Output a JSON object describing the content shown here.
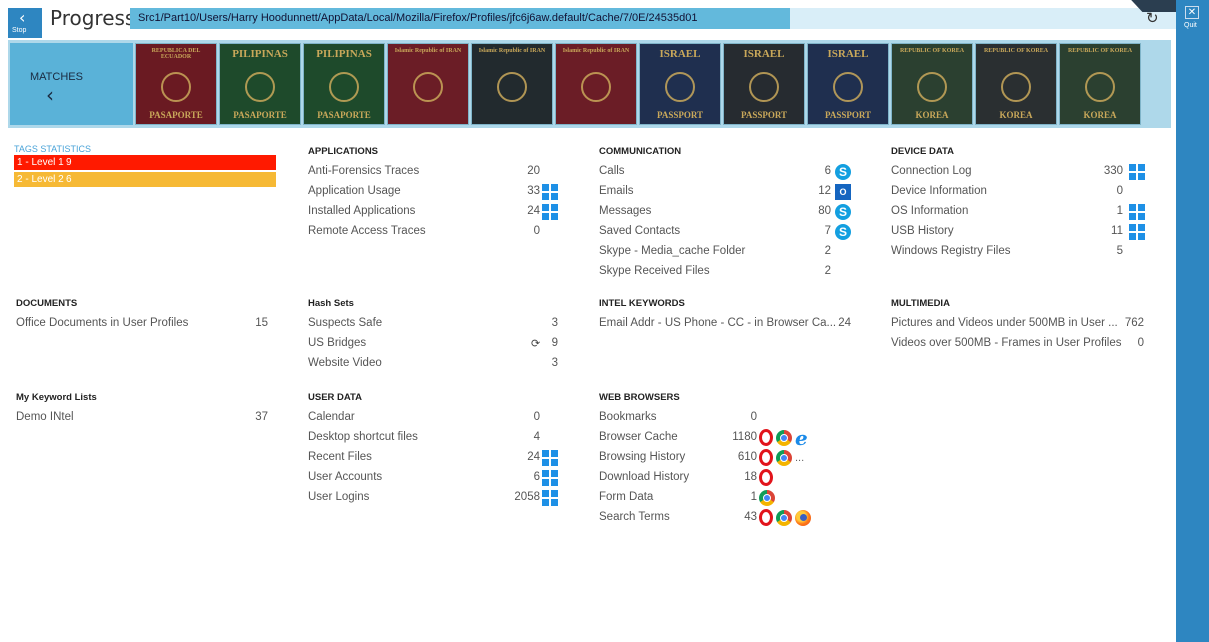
{
  "window": {
    "title": "Progress",
    "stop_label": "Stop",
    "quit_label": "Quit",
    "path": "Src1/Part10/Users/Harry Hoodunnett/AppData/Local/Mozilla/Firefox/Profiles/jfc6j6aw.default/Cache/7/0E/24535d01"
  },
  "matches": {
    "label": "MATCHES",
    "passports": [
      {
        "country": "REPUBLICA DEL ECUADOR",
        "bottom": "PASAPORTE",
        "color": "#6a1a22"
      },
      {
        "country": "PILIPINAS",
        "bottom": "PASAPORTE",
        "color": "#1e4a2b"
      },
      {
        "country": "PILIPINAS",
        "bottom": "PASAPORTE",
        "color": "#1e4a2b"
      },
      {
        "country": "Islamic Republic of IRAN",
        "bottom": "",
        "color": "#6b1d26"
      },
      {
        "country": "Islamic Republic of IRAN",
        "bottom": "",
        "color": "#222a2e"
      },
      {
        "country": "Islamic Republic of IRAN",
        "bottom": "",
        "color": "#6b1d26"
      },
      {
        "country": "ISRAEL",
        "bottom": "PASSPORT",
        "color": "#1f2f4f"
      },
      {
        "country": "ISRAEL",
        "bottom": "PASSPORT",
        "color": "#262b30"
      },
      {
        "country": "ISRAEL",
        "bottom": "PASSPORT",
        "color": "#1f2f4f"
      },
      {
        "country": "REPUBLIC OF KOREA",
        "bottom": "KOREA",
        "color": "#2b4030"
      },
      {
        "country": "REPUBLIC OF KOREA",
        "bottom": "KOREA",
        "color": "#2a2f31"
      },
      {
        "country": "REPUBLIC OF KOREA",
        "bottom": "KOREA",
        "color": "#2b4030"
      }
    ]
  },
  "tags": {
    "title": "TAGS STATISTICS",
    "items": [
      {
        "label": "1 - Level 1",
        "count": "9",
        "color": "#ff1a00"
      },
      {
        "label": "2 - Level 2",
        "count": "6",
        "color": "#f6b935"
      }
    ]
  },
  "sections": {
    "applications": {
      "title": "APPLICATIONS",
      "rows": [
        {
          "name": "Anti-Forensics Traces",
          "value": "20"
        },
        {
          "name": "Application Usage",
          "value": "33"
        },
        {
          "name": "Installed Applications",
          "value": "24"
        },
        {
          "name": "Remote Access Traces",
          "value": "0"
        }
      ]
    },
    "communication": {
      "title": "COMMUNICATION",
      "rows": [
        {
          "name": "Calls",
          "value": "6"
        },
        {
          "name": "Emails",
          "value": "12"
        },
        {
          "name": "Messages",
          "value": "80"
        },
        {
          "name": "Saved Contacts",
          "value": "7"
        },
        {
          "name": "Skype - Media_cache Folder",
          "value": "2"
        },
        {
          "name": "Skype Received Files",
          "value": "2"
        }
      ]
    },
    "device_data": {
      "title": "DEVICE DATA",
      "rows": [
        {
          "name": "Connection Log",
          "value": "330"
        },
        {
          "name": "Device Information",
          "value": "0"
        },
        {
          "name": "OS Information",
          "value": "1"
        },
        {
          "name": "USB History",
          "value": "11"
        },
        {
          "name": "Windows Registry Files",
          "value": "5"
        }
      ]
    },
    "documents": {
      "title": "DOCUMENTS",
      "rows": [
        {
          "name": "Office Documents in User Profiles",
          "value": "15"
        }
      ]
    },
    "hash_sets": {
      "title": "Hash Sets",
      "rows": [
        {
          "name": "Suspects Safe",
          "value": "3"
        },
        {
          "name": "US Bridges",
          "value": "9"
        },
        {
          "name": "Website Video",
          "value": "3"
        }
      ]
    },
    "intel_keywords": {
      "title": "INTEL KEYWORDS",
      "rows": [
        {
          "name": "Email Addr - US Phone - CC - in Browser Ca...",
          "value": "24"
        }
      ]
    },
    "multimedia": {
      "title": "MULTIMEDIA",
      "rows": [
        {
          "name": "Pictures and Videos under 500MB in User ...",
          "value": "762"
        },
        {
          "name": "Videos over 500MB - Frames in User Profiles",
          "value": "0"
        }
      ]
    },
    "keyword_lists": {
      "title": "My Keyword Lists",
      "rows": [
        {
          "name": "Demo INtel",
          "value": "37"
        }
      ]
    },
    "user_data": {
      "title": "USER DATA",
      "rows": [
        {
          "name": "Calendar",
          "value": "0"
        },
        {
          "name": "Desktop shortcut files",
          "value": "4"
        },
        {
          "name": "Recent Files",
          "value": "24"
        },
        {
          "name": "User Accounts",
          "value": "6"
        },
        {
          "name": "User Logins",
          "value": "2058"
        }
      ]
    },
    "web_browsers": {
      "title": "WEB BROWSERS",
      "rows": [
        {
          "name": "Bookmarks",
          "value": "0"
        },
        {
          "name": "Browser Cache",
          "value": "1180"
        },
        {
          "name": "Browsing History",
          "value": "610"
        },
        {
          "name": "Download History",
          "value": "18"
        },
        {
          "name": "Form Data",
          "value": "1"
        },
        {
          "name": "Search Terms",
          "value": "43"
        }
      ],
      "more": "..."
    }
  },
  "icons": {
    "applications": [
      "",
      "windows-icon",
      "windows-icon",
      ""
    ],
    "communication": [
      "skype-icon",
      "outlook-icon",
      "skype-icon",
      "skype-icon",
      "",
      ""
    ],
    "device_data": [
      "windows-icon",
      "",
      "windows-icon",
      "windows-icon",
      ""
    ],
    "user_data": [
      "",
      "",
      "windows-icon",
      "windows-icon",
      "windows-icon"
    ],
    "web_browsers": [
      [],
      [
        "opera-icon",
        "chrome-icon",
        "ie-icon"
      ],
      [
        "opera-icon",
        "chrome-icon"
      ],
      [
        "opera-icon"
      ],
      [
        "chrome-icon"
      ],
      [
        "opera-icon",
        "chrome-icon",
        "firefox-icon"
      ]
    ],
    "hash_sets": [
      "",
      "sync-icon",
      ""
    ]
  }
}
